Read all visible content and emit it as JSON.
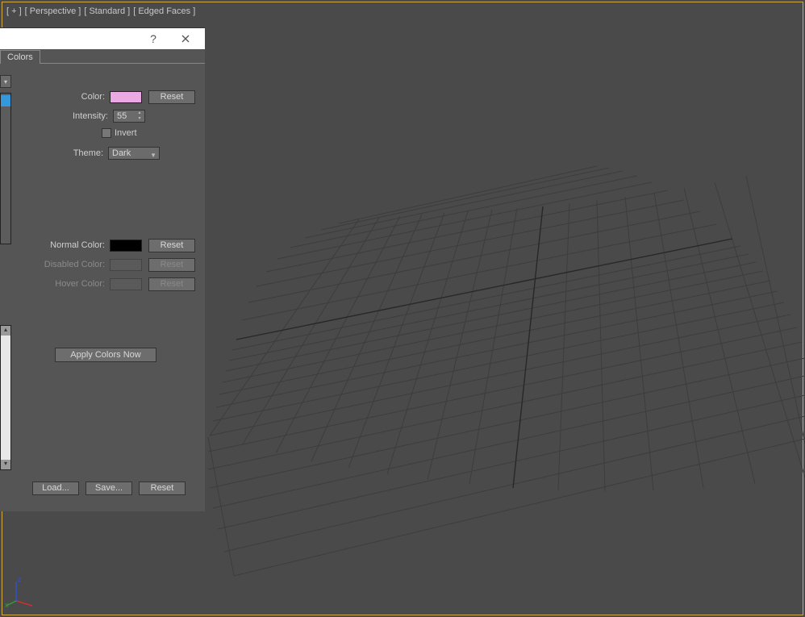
{
  "viewport": {
    "labels": [
      "[ + ]",
      "[ Perspective ]",
      "[ Standard ]",
      "[ Edged Faces ]"
    ]
  },
  "dialog": {
    "tab_label": "Colors",
    "fields": {
      "color_label": "Color:",
      "color_value": "#eba9e3",
      "reset": "Reset",
      "intensity_label": "Intensity:",
      "intensity_value": "55",
      "invert_label": "Invert",
      "theme_label": "Theme:",
      "theme_value": "Dark",
      "normal_label": "Normal Color:",
      "normal_value": "#000000",
      "disabled_label": "Disabled Color:",
      "hover_label": "Hover Color:",
      "apply": "Apply Colors Now"
    },
    "buttons": {
      "load": "Load...",
      "save": "Save...",
      "reset": "Reset"
    }
  },
  "axis": {
    "x": "x",
    "z": "z"
  }
}
